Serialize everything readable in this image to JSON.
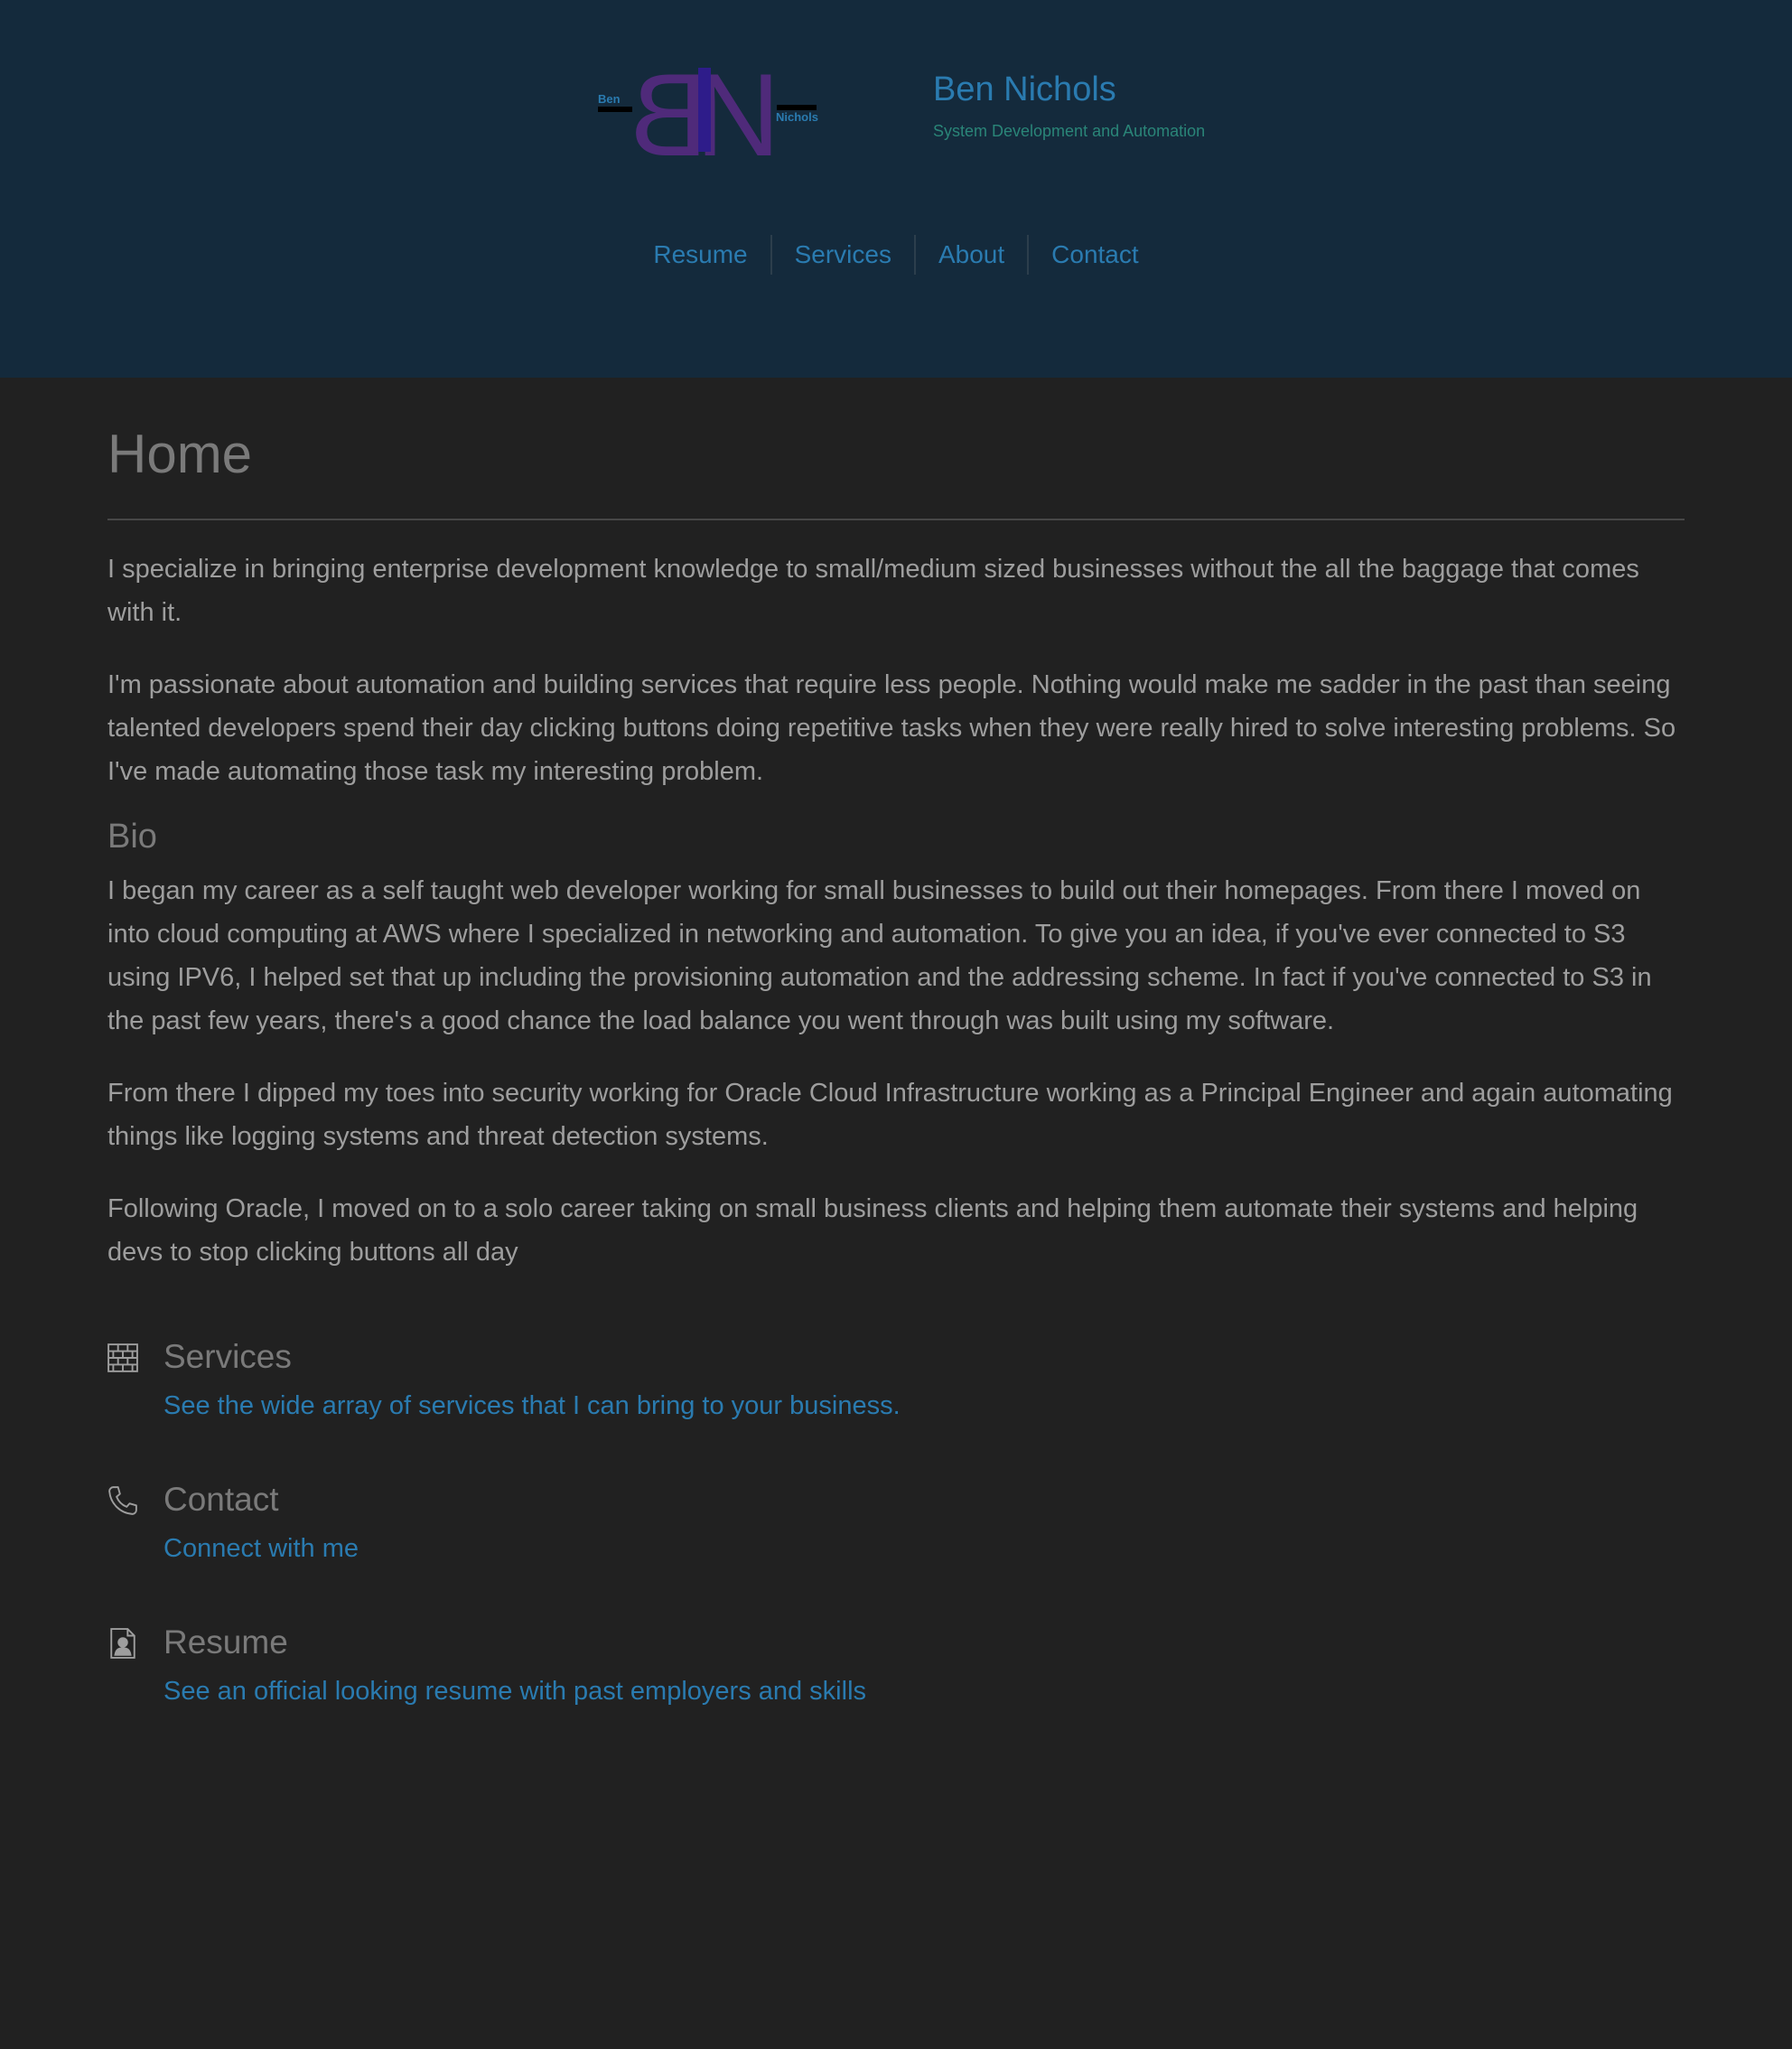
{
  "header": {
    "logo": {
      "first_name": "Ben",
      "last_name": "Nichols",
      "initials": "BN"
    },
    "title": "Ben Nichols",
    "tagline": "System Development and Automation",
    "nav": [
      {
        "label": "Resume"
      },
      {
        "label": "Services"
      },
      {
        "label": "About"
      },
      {
        "label": "Contact"
      }
    ]
  },
  "main": {
    "title": "Home",
    "intro": [
      "I specialize in bringing enterprise development knowledge to small/medium sized businesses without the all the baggage that comes with it.",
      "I'm passionate about automation and building services that require less people. Nothing would make me sadder in the past than seeing talented developers spend their day clicking buttons doing repetitive tasks when they were really hired to solve interesting problems. So I've made automating those task my interesting problem."
    ],
    "bio_heading": "Bio",
    "bio": [
      "I began my career as a self taught web developer working for small businesses to build out their homepages. From there I moved on into cloud computing at AWS where I specialized in networking and automation. To give you an idea, if you've ever connected to S3 using IPV6, I helped set that up including the provisioning automation and the addressing scheme. In fact if you've connected to S3 in the past few years, there's a good chance the load balance you went through was built using my software.",
      "From there I dipped my toes into security working for Oracle Cloud Infrastructure working as a Principal Engineer and again automating things like logging systems and threat detection systems.",
      "Following Oracle, I moved on to a solo career taking on small business clients and helping them automate their systems and helping devs to stop clicking buttons all day"
    ],
    "cards": [
      {
        "icon": "brick-wall-icon",
        "title": "Services",
        "link": "See the wide array of services that I can bring to your business."
      },
      {
        "icon": "phone-icon",
        "title": "Contact",
        "link": "Connect with me"
      },
      {
        "icon": "resume-document-icon",
        "title": "Resume",
        "link": "See an official looking resume with past employers and skills"
      }
    ]
  },
  "colors": {
    "header_bg": "#142a3c",
    "page_bg": "#212121",
    "link": "#2a7bb0",
    "tagline": "#2a8578",
    "logo_purple": "#4f2a7a",
    "logo_indigo": "#2e1c8a"
  }
}
